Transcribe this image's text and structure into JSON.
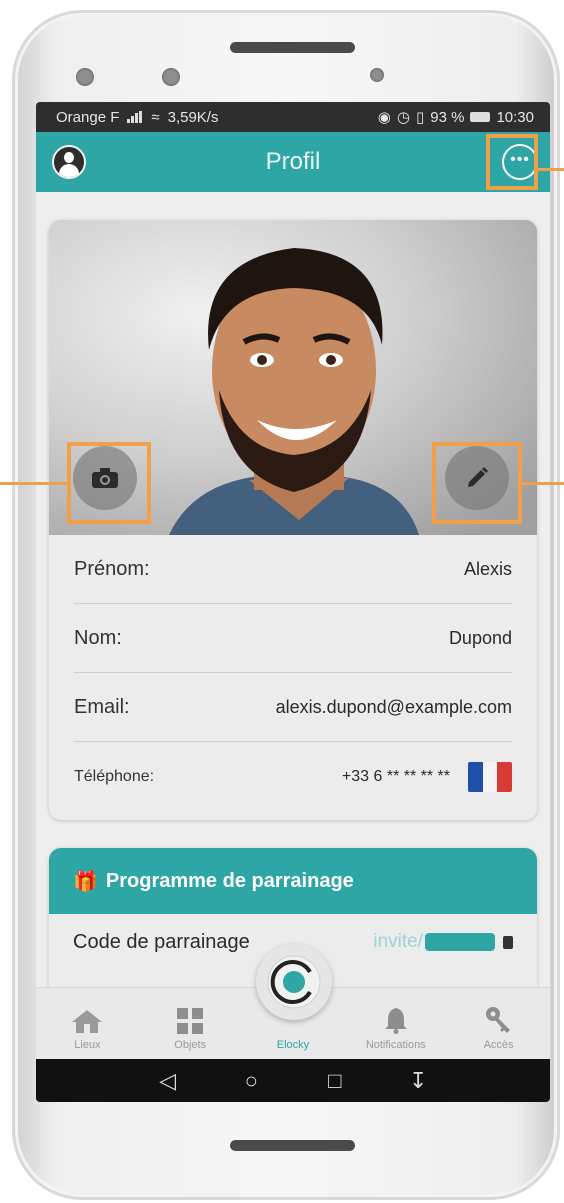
{
  "status_bar": {
    "carrier": "Orange F",
    "speed": "3,59K/s",
    "battery": "93 %",
    "time": "10:30"
  },
  "app_bar": {
    "title": "Profil"
  },
  "profile": {
    "fields": [
      {
        "label": "Prénom:",
        "value": "Alexis"
      },
      {
        "label": "Nom:",
        "value": "Dupond"
      },
      {
        "label": "Email:",
        "value": "alexis.dupond@example.com"
      },
      {
        "label": "Téléphone:",
        "value": "+33 6 ** ** ** **"
      }
    ]
  },
  "referral": {
    "title": "Programme de parrainage",
    "code_label": "Code de parrainage",
    "code_prefix": "invite/"
  },
  "bottom_nav": {
    "items": [
      {
        "label": "Lieux"
      },
      {
        "label": "Objets"
      },
      {
        "label": "Elocky",
        "active": true
      },
      {
        "label": "Notifications"
      },
      {
        "label": "Accès"
      }
    ]
  },
  "colors": {
    "accent": "#2ea6a5",
    "highlight": "#f0a04b"
  },
  "icons": [
    "user-avatar-icon",
    "more-options-icon",
    "camera-icon",
    "pencil-icon",
    "gift-icon",
    "home-icon",
    "grid-icon",
    "elocky-logo-icon",
    "bell-icon",
    "key-icon",
    "back-icon",
    "home-circle-icon",
    "recents-icon",
    "notification-shade-icon"
  ]
}
